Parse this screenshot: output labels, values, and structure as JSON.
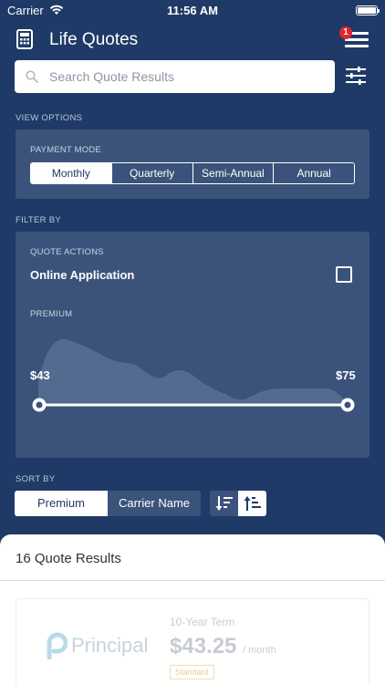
{
  "status": {
    "carrier": "Carrier",
    "time": "11:56 AM"
  },
  "nav": {
    "title": "Life Quotes",
    "badge_count": "1"
  },
  "search": {
    "placeholder": "Search Quote Results"
  },
  "view_options": {
    "label": "VIEW OPTIONS",
    "payment_mode_label": "PAYMENT MODE",
    "modes": [
      "Monthly",
      "Quarterly",
      "Semi-Annual",
      "Annual"
    ],
    "selected": "Monthly"
  },
  "filter_by": {
    "label": "FILTER BY",
    "quote_actions_label": "QUOTE ACTIONS",
    "online_application_label": "Online Application",
    "online_application_checked": false,
    "premium_label": "PREMIUM",
    "premium_min": "$43",
    "premium_max": "$75"
  },
  "sort_by": {
    "label": "SORT BY",
    "options": [
      "Premium",
      "Carrier Name"
    ],
    "selected": "Premium",
    "direction": "ascending"
  },
  "results": {
    "title": "16 Quote Results",
    "items": [
      {
        "carrier": "Principal",
        "term": "10-Year Term",
        "price": "$43.25",
        "per": "/ month",
        "tag": "Standard"
      }
    ]
  },
  "colors": {
    "background": "#1f3a66",
    "panel": "#3b537b",
    "badge": "#e0262c"
  },
  "icons": [
    "wifi-icon",
    "battery-icon",
    "calculator-icon",
    "menu-icon",
    "search-icon",
    "filter-sliders-icon",
    "sort-descending-icon",
    "sort-ascending-icon",
    "principal-logo-icon"
  ]
}
